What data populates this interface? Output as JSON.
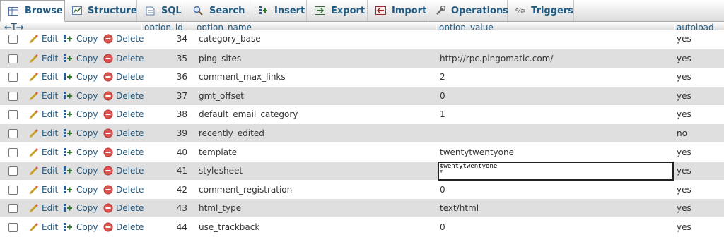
{
  "tabs": [
    {
      "label": "Browse",
      "icon": "browse-icon",
      "active": true
    },
    {
      "label": "Structure",
      "icon": "structure-icon"
    },
    {
      "label": "SQL",
      "icon": "sql-icon"
    },
    {
      "label": "Search",
      "icon": "search-icon"
    },
    {
      "label": "Insert",
      "icon": "insert-icon"
    },
    {
      "label": "Export",
      "icon": "export-icon"
    },
    {
      "label": "Import",
      "icon": "import-icon"
    },
    {
      "label": "Operations",
      "icon": "operations-icon"
    },
    {
      "label": "Triggers",
      "icon": "triggers-icon"
    }
  ],
  "table": {
    "arrows": "←T→",
    "columns": {
      "option_id": "option_id",
      "option_name": "option_name",
      "option_value": "option_value",
      "autoload": "autoload"
    },
    "actions": {
      "edit": "Edit",
      "copy": "Copy",
      "delete": "Delete"
    },
    "rows": [
      {
        "id": "34",
        "name": "category_base",
        "value": "",
        "autoload": "yes"
      },
      {
        "id": "35",
        "name": "ping_sites",
        "value": "http://rpc.pingomatic.com/",
        "autoload": "yes"
      },
      {
        "id": "36",
        "name": "comment_max_links",
        "value": "2",
        "autoload": "yes"
      },
      {
        "id": "37",
        "name": "gmt_offset",
        "value": "0",
        "autoload": "yes"
      },
      {
        "id": "38",
        "name": "default_email_category",
        "value": "1",
        "autoload": "yes"
      },
      {
        "id": "39",
        "name": "recently_edited",
        "value": "",
        "autoload": "no"
      },
      {
        "id": "40",
        "name": "template",
        "value": "twentytwentyone",
        "autoload": "yes"
      },
      {
        "id": "41",
        "name": "stylesheet",
        "value": "",
        "autoload": "yes",
        "editing": true,
        "edit_value": "twentytwentyone"
      },
      {
        "id": "42",
        "name": "comment_registration",
        "value": "0",
        "autoload": "yes"
      },
      {
        "id": "43",
        "name": "html_type",
        "value": "text/html",
        "autoload": "yes"
      },
      {
        "id": "44",
        "name": "use_trackback",
        "value": "0",
        "autoload": "yes"
      }
    ]
  }
}
